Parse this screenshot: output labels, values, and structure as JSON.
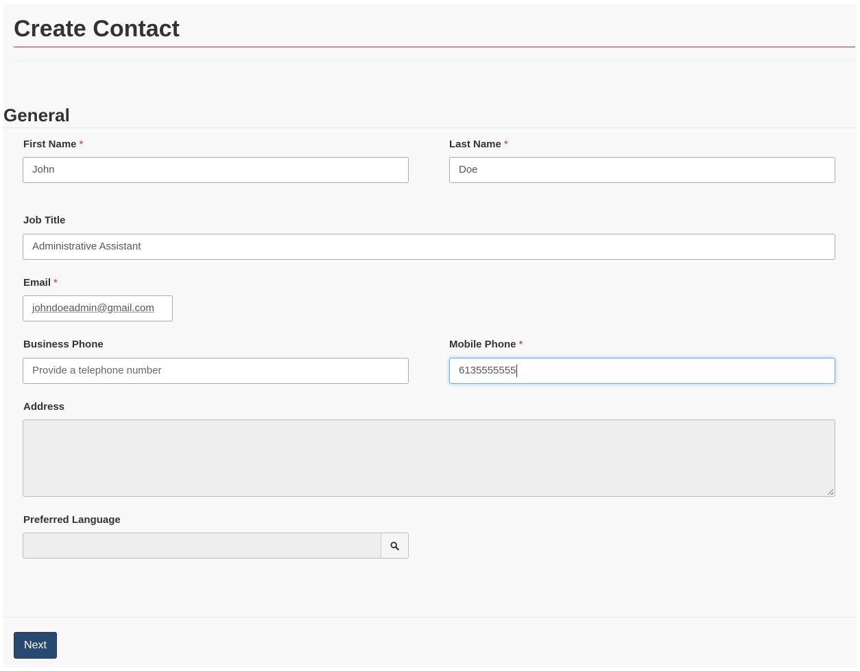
{
  "page": {
    "title": "Create Contact"
  },
  "section": {
    "title": "General"
  },
  "required_marker": "*",
  "fields": {
    "first_name": {
      "label": "First Name",
      "value": "John"
    },
    "last_name": {
      "label": "Last Name",
      "value": "Doe"
    },
    "job_title": {
      "label": "Job Title",
      "value": "Administrative Assistant"
    },
    "email": {
      "label": "Email",
      "value": "johndoeadmin@gmail.com"
    },
    "business_phone": {
      "label": "Business Phone",
      "placeholder": "Provide a telephone number"
    },
    "mobile_phone": {
      "label": "Mobile Phone",
      "value": "6135555555"
    },
    "address": {
      "label": "Address"
    },
    "preferred_language": {
      "label": "Preferred Language",
      "icon": "search-icon"
    }
  },
  "footer": {
    "next_label": "Next"
  },
  "colors": {
    "required": "#c9303a",
    "primary_button": "#294a70",
    "focus": "#66afe9"
  }
}
